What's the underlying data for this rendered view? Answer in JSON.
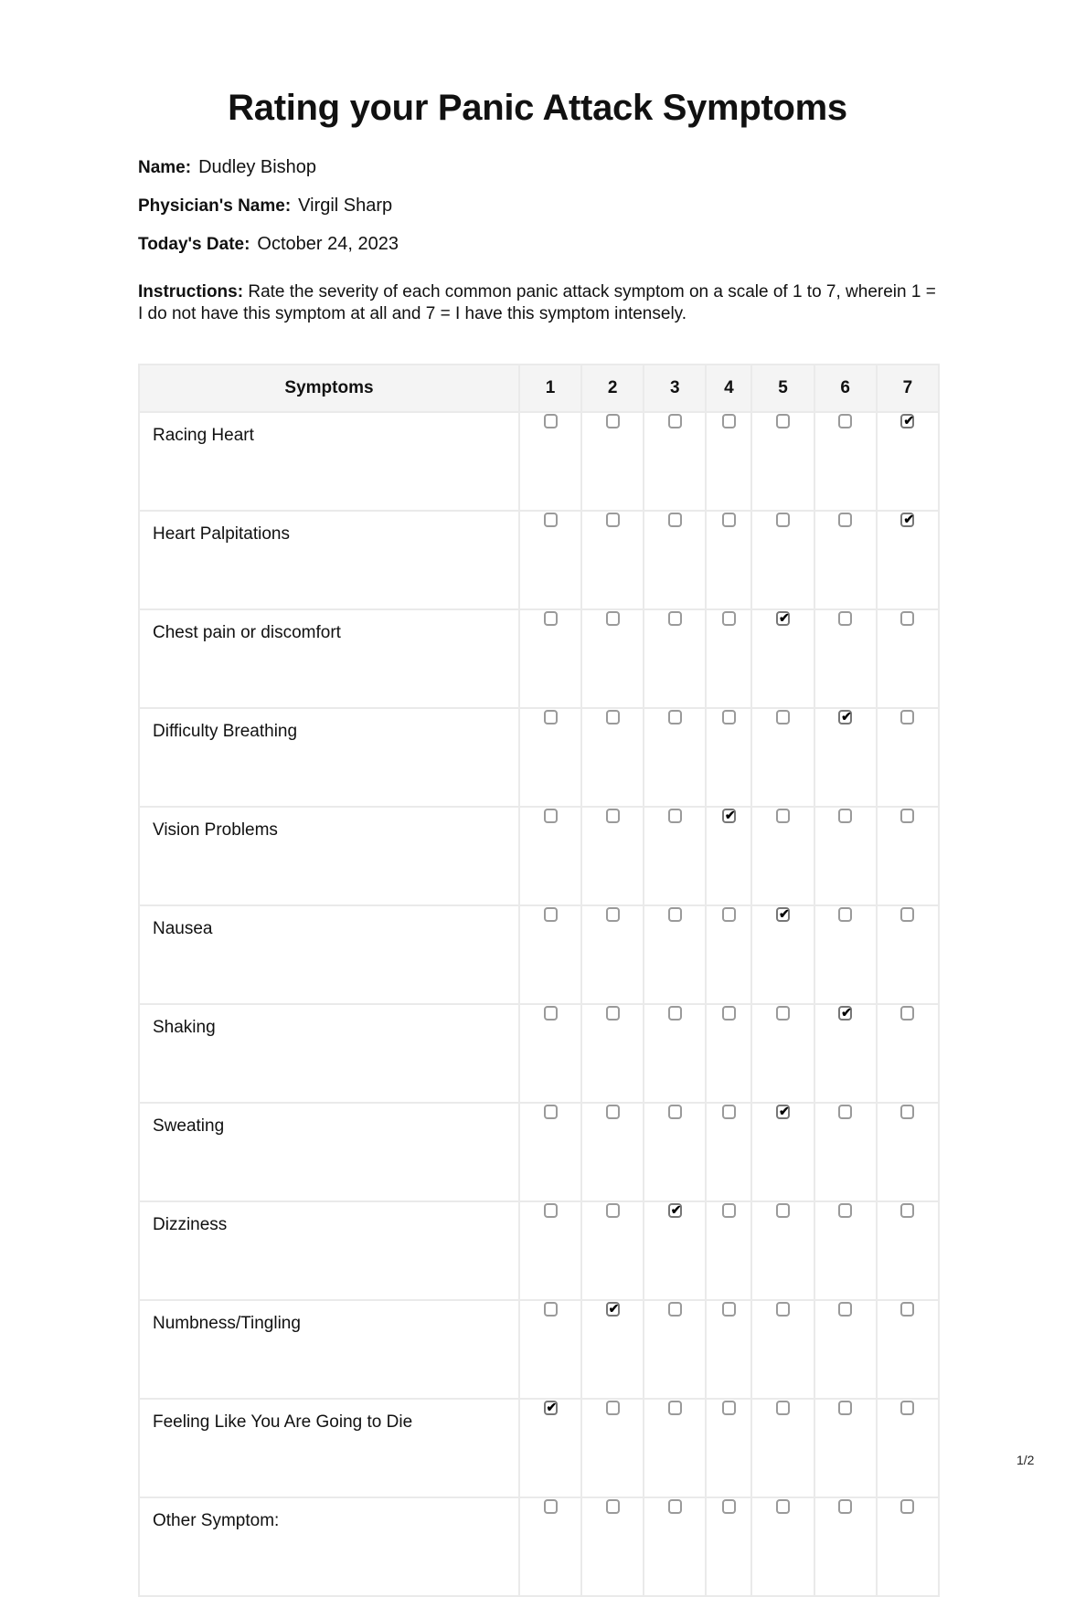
{
  "document": {
    "title": "Rating your Panic Attack Symptoms",
    "fields": {
      "name": {
        "label": "Name:",
        "value": "Dudley Bishop"
      },
      "physician": {
        "label": "Physician's Name:",
        "value": "Virgil Sharp"
      },
      "date": {
        "label": "Today's Date:",
        "value": "October 24, 2023"
      }
    },
    "instructions": {
      "label": "Instructions:",
      "text": "Rate the severity of each common panic attack symptom on a scale of 1 to 7, wherein 1 = I do not have this symptom at all and 7 = I have this symptom intensely."
    },
    "table": {
      "headers": [
        "Symptoms",
        "1",
        "2",
        "3",
        "4",
        "5",
        "6",
        "7"
      ],
      "check_glyph": "✔",
      "rows": [
        {
          "symptom": "Racing Heart",
          "rating": 7
        },
        {
          "symptom": "Heart Palpitations",
          "rating": 7
        },
        {
          "symptom": "Chest pain or discomfort",
          "rating": 5
        },
        {
          "symptom": "Difficulty Breathing",
          "rating": 6
        },
        {
          "symptom": "Vision Problems",
          "rating": 4
        },
        {
          "symptom": "Nausea",
          "rating": 5
        },
        {
          "symptom": "Shaking",
          "rating": 6
        },
        {
          "symptom": "Sweating",
          "rating": 5
        },
        {
          "symptom": "Dizziness",
          "rating": 3
        },
        {
          "symptom": "Numbness/Tingling",
          "rating": 2
        },
        {
          "symptom": "Feeling Like You Are Going to Die",
          "rating": 1
        },
        {
          "symptom": "Other Symptom:",
          "rating": null
        }
      ]
    },
    "page_number": "1/2"
  }
}
